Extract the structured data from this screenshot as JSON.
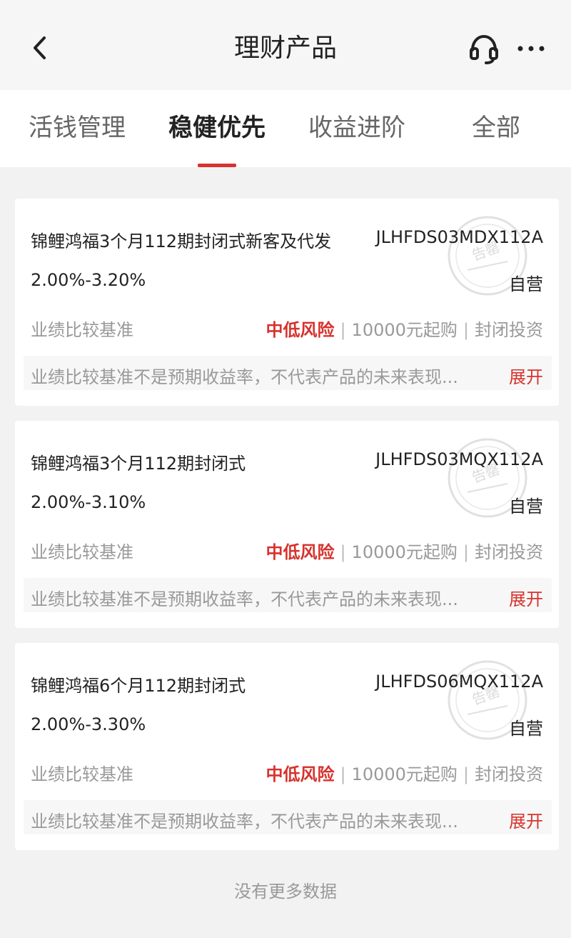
{
  "header": {
    "title": "理财产品",
    "back_icon": "chevron-left-icon",
    "service_icon": "headset-icon",
    "more_icon": "more-horizontal-icon"
  },
  "tabs": [
    {
      "label": "活钱管理",
      "active": false
    },
    {
      "label": "稳健优先",
      "active": true
    },
    {
      "label": "收益进阶",
      "active": false
    },
    {
      "label": "全部",
      "active": false
    }
  ],
  "products": [
    {
      "name": "锦鲤鸿福3个月112期封闭式新客及代发",
      "code": "JLHFDS03MDX112A",
      "rate": "2.00%-3.20%",
      "self_run": "自营",
      "bench_label": "业绩比较基准",
      "risk": "中低风险",
      "min_buy": "10000元起购",
      "type": "封闭投资",
      "disclaimer": "业绩比较基准不是预期收益率，不代表产品的未来表现...",
      "expand": "展开",
      "stamp": "告罄"
    },
    {
      "name": "锦鲤鸿福3个月112期封闭式",
      "code": "JLHFDS03MQX112A",
      "rate": "2.00%-3.10%",
      "self_run": "自营",
      "bench_label": "业绩比较基准",
      "risk": "中低风险",
      "min_buy": "10000元起购",
      "type": "封闭投资",
      "disclaimer": "业绩比较基准不是预期收益率，不代表产品的未来表现...",
      "expand": "展开",
      "stamp": "告罄"
    },
    {
      "name": "锦鲤鸿福6个月112期封闭式",
      "code": "JLHFDS06MQX112A",
      "rate": "2.00%-3.30%",
      "self_run": "自营",
      "bench_label": "业绩比较基准",
      "risk": "中低风险",
      "min_buy": "10000元起购",
      "type": "封闭投资",
      "disclaimer": "业绩比较基准不是预期收益率，不代表产品的未来表现...",
      "expand": "展开",
      "stamp": "告罄"
    }
  ],
  "footer": {
    "text": "没有更多数据"
  },
  "colors": {
    "accent": "#d7322d",
    "muted": "#999999",
    "text": "#222222"
  }
}
